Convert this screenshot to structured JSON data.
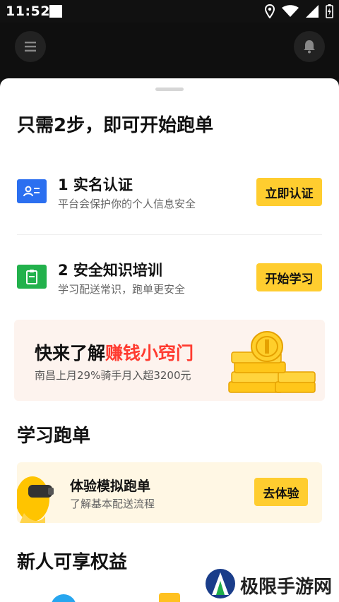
{
  "status_bar": {
    "time": "11:52",
    "icons": [
      "location-icon",
      "wifi-icon",
      "signal-icon",
      "battery-icon"
    ]
  },
  "header": {
    "icons": [
      "menu-icon",
      "bell-icon"
    ]
  },
  "sheet": {
    "title": "只需2步，即可开始跑单",
    "steps": [
      {
        "title": "1 实名认证",
        "subtitle": "平台会保护你的个人信息安全",
        "button": "立即认证",
        "icon": "id-card-icon",
        "icon_color": "#2b6ff0"
      },
      {
        "title": "2 安全知识培训",
        "subtitle": "学习配送常识，跑单更安全",
        "button": "开始学习",
        "icon": "clipboard-icon",
        "icon_color": "#22b14c"
      }
    ],
    "promo": {
      "title_prefix": "快来了解",
      "title_highlight": "赚钱小窍门",
      "subtitle": "南昌上月29%骑手月入超3200元",
      "highlight_color": "#ff3b30",
      "icon": "coins-icon"
    },
    "learn_section": {
      "title": "学习跑单",
      "card": {
        "title": "体验模拟跑单",
        "subtitle": "了解基本配送流程",
        "button": "去体验",
        "icon": "vr-mascot-icon"
      }
    },
    "rights_section": {
      "title": "新人可享权益"
    }
  },
  "watermark": {
    "text": "极限手游网"
  },
  "colors": {
    "accent": "#ffcd2f",
    "background_dark": "#111111",
    "promo_bg": "#fdf3ee",
    "learn_bg": "#fff7e4"
  }
}
